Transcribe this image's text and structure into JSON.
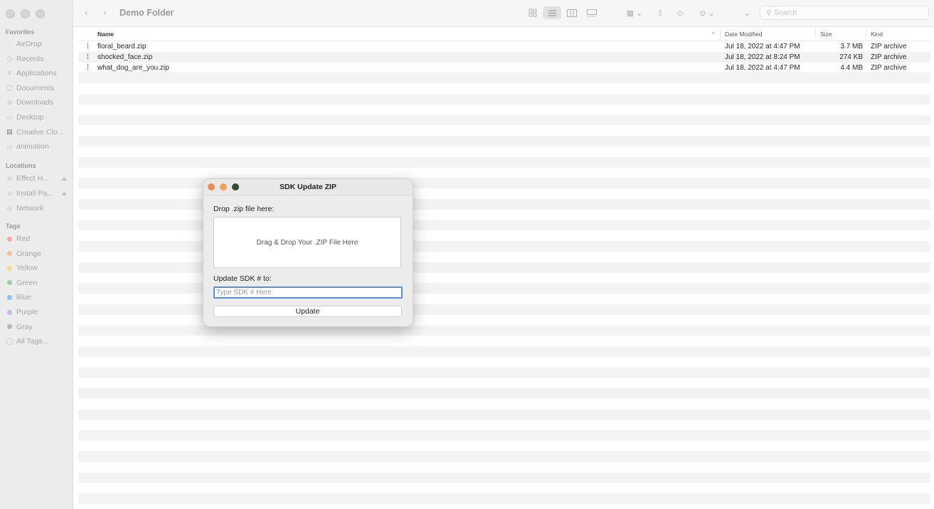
{
  "toolbar": {
    "folder_title": "Demo Folder",
    "back_glyph": "‹",
    "forward_glyph": "›",
    "search_placeholder": "Search"
  },
  "sidebar": {
    "favorites_header": "Favorites",
    "favorites": [
      {
        "label": "AirDrop",
        "icon": "airdrop-icon"
      },
      {
        "label": "Recents",
        "icon": "clock-icon"
      },
      {
        "label": "Applications",
        "icon": "applications-icon"
      },
      {
        "label": "Documents",
        "icon": "document-icon"
      },
      {
        "label": "Downloads",
        "icon": "download-icon"
      },
      {
        "label": "Desktop",
        "icon": "desktop-icon"
      },
      {
        "label": "Creative Clo...",
        "icon": "file-icon"
      },
      {
        "label": "animation",
        "icon": "folder-icon"
      }
    ],
    "locations_header": "Locations",
    "locations": [
      {
        "label": "Effect H...",
        "icon": "drive-icon"
      },
      {
        "label": "Install Pa...",
        "icon": "drive-icon"
      },
      {
        "label": "Network",
        "icon": "network-icon"
      }
    ],
    "tags_header": "Tags",
    "tags": [
      {
        "label": "Red",
        "color": "#f0a8a0"
      },
      {
        "label": "Orange",
        "color": "#f4c28d"
      },
      {
        "label": "Yellow",
        "color": "#f3d98a"
      },
      {
        "label": "Green",
        "color": "#9ccfa0"
      },
      {
        "label": "Blue",
        "color": "#8fc0f0"
      },
      {
        "label": "Purple",
        "color": "#d2b3ea"
      },
      {
        "label": "Gray",
        "color": "#b8b8b8"
      },
      {
        "label": "All Tags...",
        "color": ""
      }
    ]
  },
  "list": {
    "columns": {
      "name": "Name",
      "date": "Date Modified",
      "size": "Size",
      "kind": "Kind"
    },
    "files": [
      {
        "name": "floral_beard.zip",
        "date": "Jul 18, 2022 at 4:47 PM",
        "size": "3.7 MB",
        "kind": "ZIP archive"
      },
      {
        "name": "shocked_face.zip",
        "date": "Jul 18, 2022 at 8:24 PM",
        "size": "274 KB",
        "kind": "ZIP archive"
      },
      {
        "name": "what_dog_are_you.zip",
        "date": "Jul 18, 2022 at 4:47 PM",
        "size": "4.4 MB",
        "kind": "ZIP archive"
      }
    ]
  },
  "dialog": {
    "title": "SDK Update ZIP",
    "drop_label": "Drop .zip file here:",
    "drop_zone_text": "Drag & Drop Your .ZIP File Here",
    "sdk_label": "Update SDK # to:",
    "sdk_placeholder": "Type SDK # Here",
    "sdk_value": "",
    "update_button": "Update",
    "lights": [
      "#ec8b5e",
      "#f0a05a",
      "#3a4a3a"
    ]
  }
}
